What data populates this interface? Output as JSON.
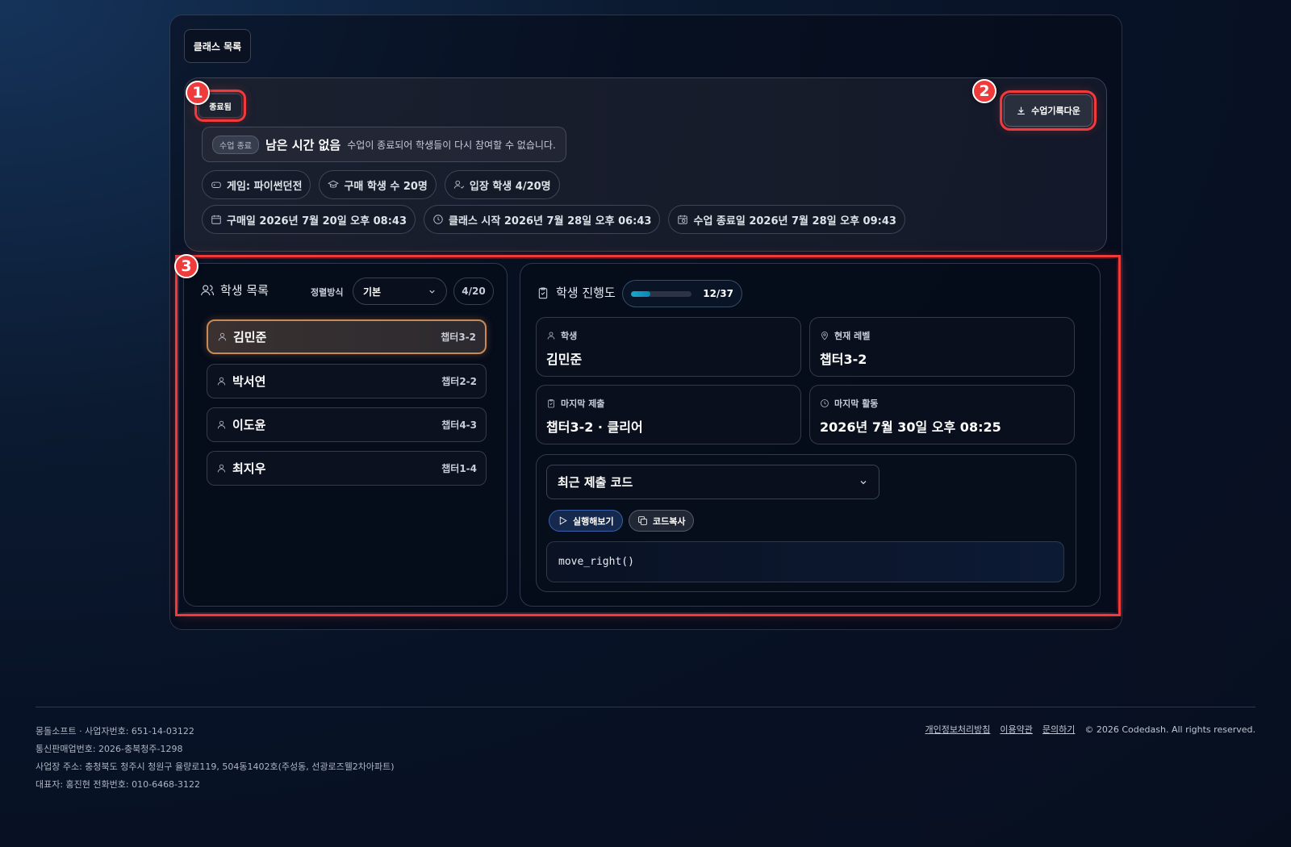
{
  "nav": {
    "back_label": "클래스 목록"
  },
  "class_info": {
    "status": "종료됨",
    "download_label": "수업기록다운",
    "end_tag": "수업 종료",
    "remaining": "남은 시간 없음",
    "message": "수업이 종료되어 학생들이 다시 참여할 수 없습니다.",
    "chips": {
      "game": "게임: 파이썬던전",
      "buyers": "구매 학생 수 20명",
      "entered": "입장 학생 4/20명",
      "purchase_date": "구매일 2026년 7월 20일 오후 08:43",
      "class_start": "클래스 시작 2026년 7월 28일 오후 06:43",
      "class_end": "수업 종료일 2026년 7월 28일 오후 09:43"
    }
  },
  "students": {
    "title": "학생 목록",
    "sort_label": "정렬방식",
    "sort_value": "기본",
    "count": "4/20",
    "items": [
      {
        "name": "김민준",
        "level": "챕터3-2"
      },
      {
        "name": "박서연",
        "level": "챕터2-2"
      },
      {
        "name": "이도윤",
        "level": "챕터4-3"
      },
      {
        "name": "최지우",
        "level": "챕터1-4"
      }
    ]
  },
  "progress": {
    "title": "학생 진행도",
    "count": "12/37",
    "fraction": 0.324,
    "stats": {
      "student_label": "학생",
      "student_value": "김민준",
      "level_label": "현재 레벨",
      "level_value": "챕터3-2",
      "submit_label": "마지막 제출",
      "submit_value": "챕터3-2 · 클리어",
      "activity_label": "마지막 활동",
      "activity_value": "2026년 7월 30일 오후 08:25"
    },
    "code": {
      "select_label": "최근 제출 코드",
      "run_label": "실행해보기",
      "copy_label": "코드복사",
      "snippet": "move_right()"
    }
  },
  "markers": [
    "1",
    "2",
    "3"
  ],
  "footer": {
    "company": "몽돌소프트 · 사업자번호: 651-14-03122",
    "commerce": "통신판매업번호: 2026-충북청주-1298",
    "address": "사업장 주소: 충청북도 청주시 청원구 율량로119, 504동1402호(주성동, 선광로즈웰2차아파트)",
    "ceo": "대표자: 홍진현 전화번호: 010-6468-3122",
    "privacy": "개인정보처리방침",
    "terms": "이용약관",
    "contact": "문의하기",
    "copyright": "© 2026 Codedash. All rights reserved."
  },
  "colors": {
    "highlight": "#ef3b3b",
    "selected_border": "#c98a55",
    "progress_fill": "#1aa8c8"
  }
}
